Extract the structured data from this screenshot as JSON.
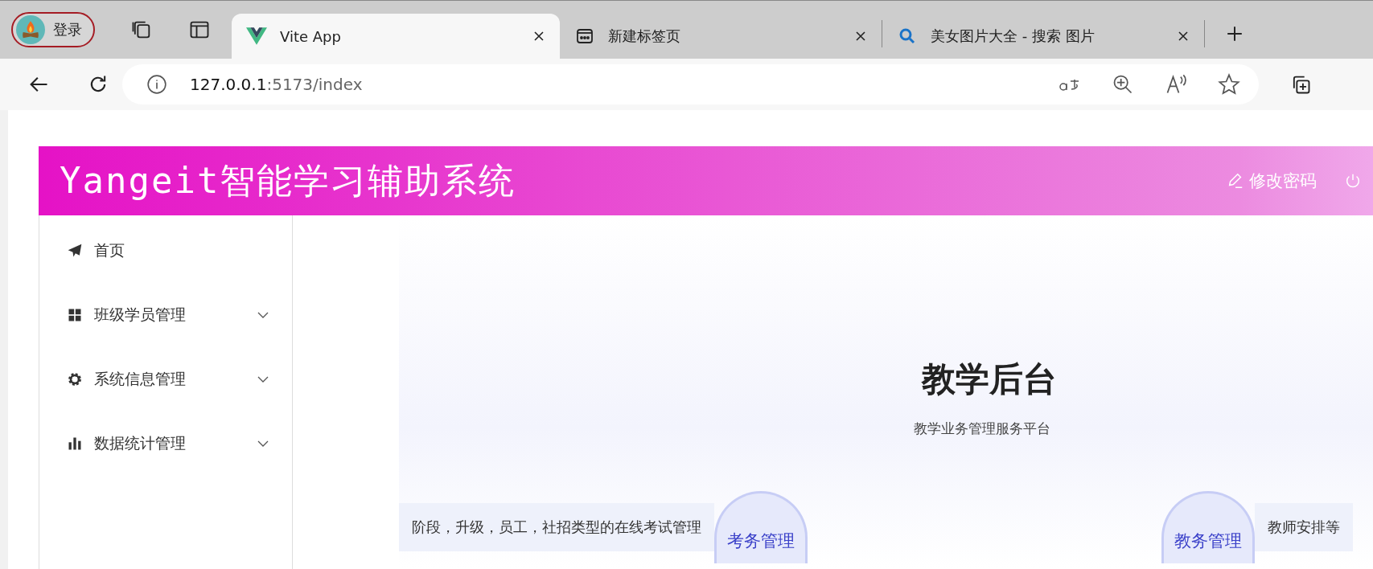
{
  "browser": {
    "profile": {
      "label": "登录"
    },
    "tabs": [
      {
        "title": "Vite App",
        "selected": true,
        "kind": "vue"
      },
      {
        "title": "新建标签页",
        "selected": false,
        "kind": "newtab"
      },
      {
        "title": "美女图片大全 - 搜索 图片",
        "selected": false,
        "kind": "search"
      }
    ],
    "address": {
      "host": "127.0.0.1",
      "rest": ":5173/index"
    }
  },
  "header": {
    "title": "Yangeit智能学习辅助系统",
    "change_password": "修改密码"
  },
  "sidebar": {
    "items": [
      {
        "label": "首页",
        "kind": "send",
        "expandable": false
      },
      {
        "label": "班级学员管理",
        "kind": "grid",
        "expandable": true
      },
      {
        "label": "系统信息管理",
        "kind": "gear",
        "expandable": true
      },
      {
        "label": "数据统计管理",
        "kind": "bars",
        "expandable": true
      }
    ]
  },
  "hero": {
    "title": "教学后台",
    "subtitle": "教学业务管理服务平台",
    "cards": [
      {
        "badge": "考务管理",
        "description": "阶段，升级，员工，社招类型的在线考试管理"
      },
      {
        "badge": "教务管理",
        "description": "教师安排等"
      }
    ]
  }
}
